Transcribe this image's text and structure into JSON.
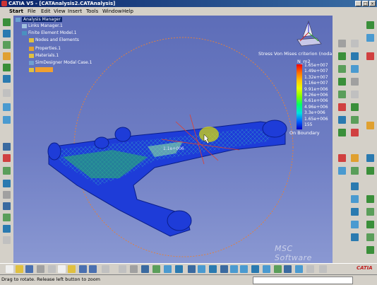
{
  "window": {
    "title": "CATIA V5 - [CATAnalysis2.CATAnalysis]"
  },
  "menu": [
    "Start",
    "File",
    "Edit",
    "View",
    "Insert",
    "Tools",
    "Window",
    "Help"
  ],
  "tree": [
    {
      "label": "Analysis Manager"
    },
    {
      "label": "Links Manager.1"
    },
    {
      "label": "Finite Element Model.1"
    },
    {
      "label": "Nodes and Elements"
    },
    {
      "label": "Properties.1"
    },
    {
      "label": "Materials.1"
    },
    {
      "label": "SimDesigner Modal Case.1"
    }
  ],
  "legend": {
    "title": "Stress Von Mises criterion (nodal v",
    "unit": "N_m2",
    "values": [
      "1.65e+007",
      "1.49e+007",
      "1.32e+007",
      "1.16e+007",
      "9.91e+006",
      "8.26e+006",
      "6.61e+006",
      "4.96e+006",
      "3.3e+006",
      "1.65e+006",
      "155"
    ],
    "footer": "On Boundary"
  },
  "probe_label": "1.1e+006",
  "watermark": "MSC Software",
  "brand": "CATIA",
  "status": {
    "message": "Drag to rotate. Release left button to zoom"
  },
  "colors": {
    "accent": "#0a246a",
    "background": "#6f7ec4",
    "circle": "#e08040"
  }
}
